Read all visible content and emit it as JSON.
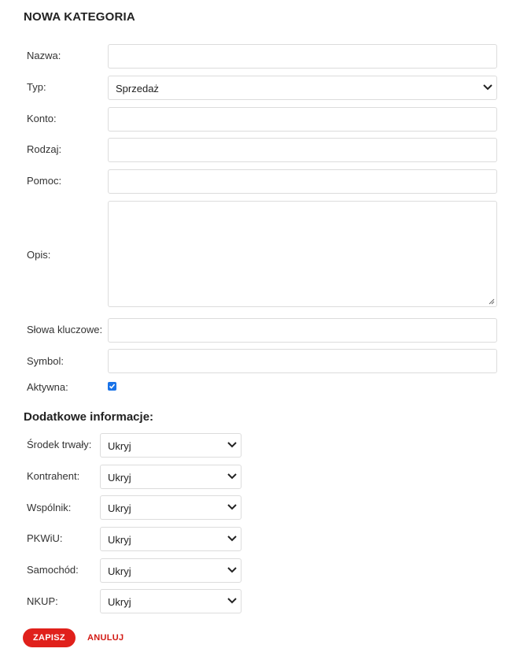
{
  "title": "NOWA KATEGORIA",
  "form": {
    "nazwa_label": "Nazwa:",
    "typ_label": "Typ:",
    "typ_value": "Sprzedaż",
    "konto_label": "Konto:",
    "rodzaj_label": "Rodzaj:",
    "pomoc_label": "Pomoc:",
    "opis_label": "Opis:",
    "slowa_label": "Słowa kluczowe:",
    "symbol_label": "Symbol:",
    "aktywna_label": "Aktywna:",
    "aktywna_checked": true
  },
  "extra": {
    "heading": "Dodatkowe informacje:",
    "fields": [
      {
        "label": "Środek trwały:",
        "value": "Ukryj"
      },
      {
        "label": "Kontrahent:",
        "value": "Ukryj"
      },
      {
        "label": "Wspólnik:",
        "value": "Ukryj"
      },
      {
        "label": "PKWiU:",
        "value": "Ukryj"
      },
      {
        "label": "Samochód:",
        "value": "Ukryj"
      },
      {
        "label": "NKUP:",
        "value": "Ukryj"
      }
    ]
  },
  "actions": {
    "save_label": "ZAPISZ",
    "cancel_label": "ANULUJ"
  },
  "colors": {
    "accent": "#e0201b",
    "checkbox": "#1a73e8"
  },
  "icons": {
    "dropdown": "chevron-down-icon",
    "resize": "resize-handle-icon",
    "check": "checkmark-icon"
  }
}
